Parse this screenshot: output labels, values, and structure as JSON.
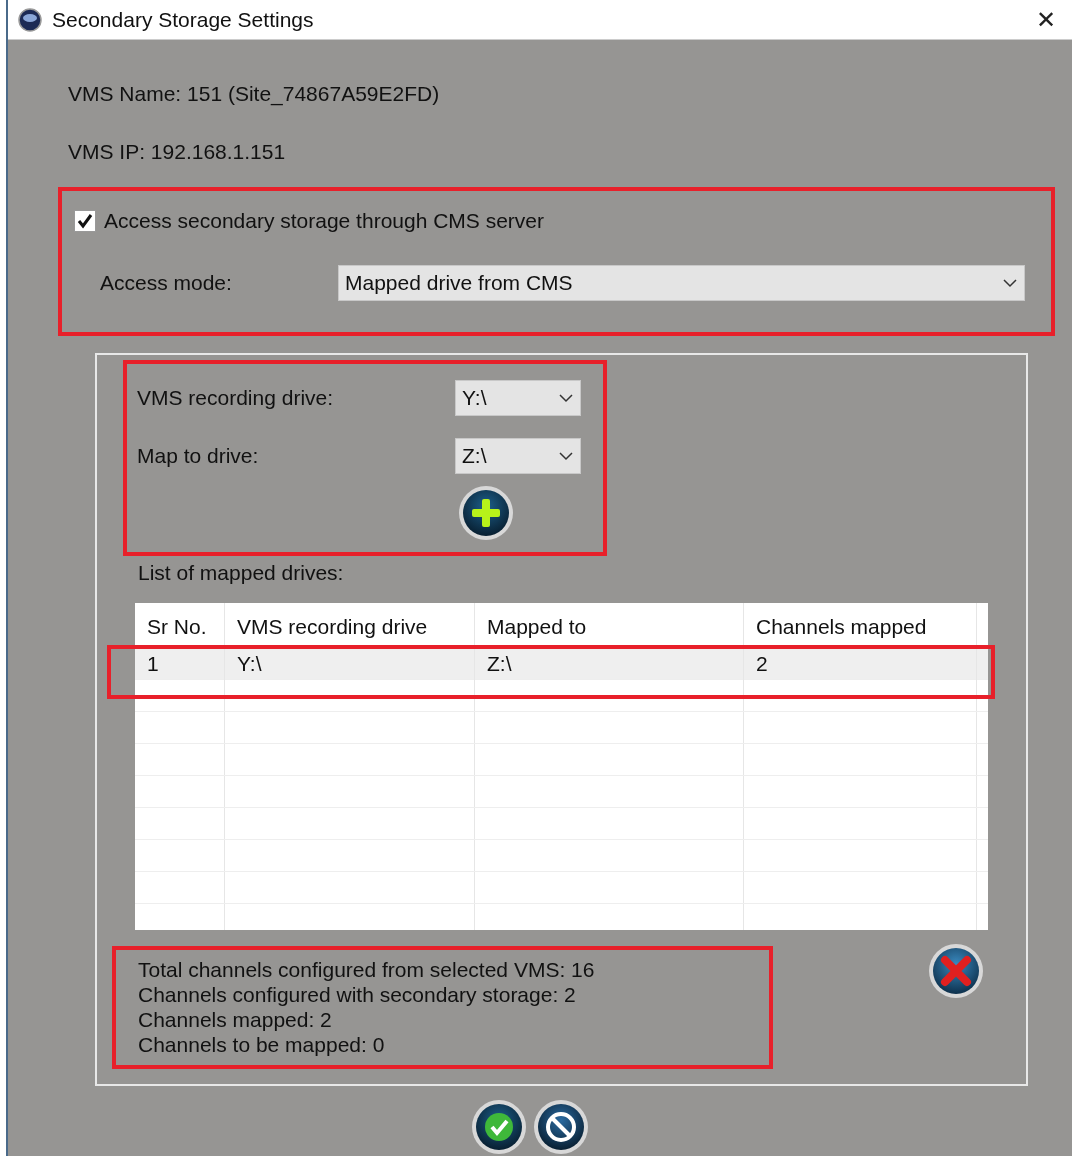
{
  "window": {
    "title": "Secondary Storage Settings",
    "close": "✕"
  },
  "info": [
    "VMS Name: 151 (Site_74867A59E2FD)",
    "VMS IP: 192.168.1.151"
  ],
  "cms_access": {
    "label": "Access secondary storage through CMS server",
    "checked": true
  },
  "access_mode": {
    "label": "Access mode:",
    "value": "Mapped drive from CMS"
  },
  "drive_fields": [
    {
      "label": "VMS recording drive:",
      "value": "Y:\\"
    },
    {
      "label": "Map to drive:",
      "value": "Z:\\"
    }
  ],
  "mapped_list": {
    "label": "List of mapped drives:",
    "columns": [
      "Sr No.",
      "VMS recording drive",
      "Mapped to",
      "Channels mapped"
    ],
    "rows": [
      {
        "cells": [
          "1",
          "Y:\\",
          "Z:\\",
          "2"
        ],
        "selected": true
      }
    ]
  },
  "summary": [
    "Total channels configured from selected VMS: 16",
    "Channels configured with secondary storage: 2",
    "Channels mapped: 2",
    "Channels to be mapped: 0"
  ]
}
